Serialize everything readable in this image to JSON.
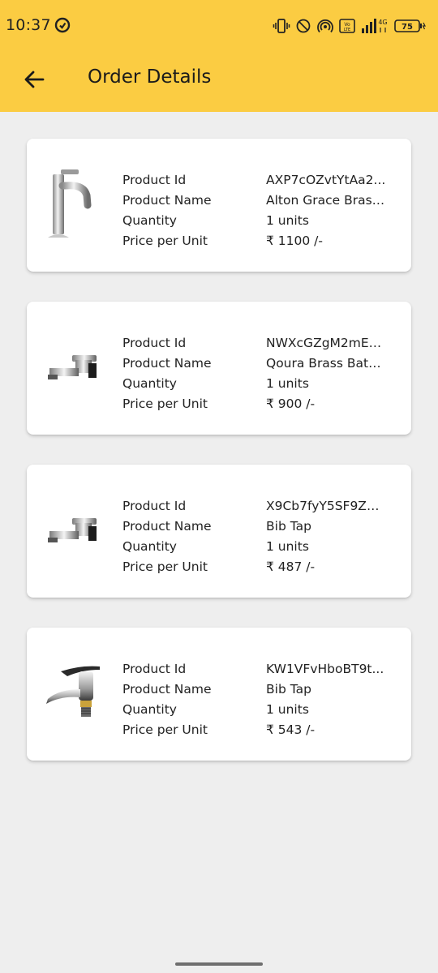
{
  "status_bar": {
    "time": "10:37",
    "network": "4G",
    "battery": "75"
  },
  "app_bar": {
    "title": "Order Details"
  },
  "labels": {
    "product_id": "Product Id",
    "product_name": "Product Name",
    "quantity": "Quantity",
    "price": "Price per Unit"
  },
  "orders": [
    {
      "product_id": "AXP7cOZvtYtAa2...",
      "product_name": "Alton Grace Brass...",
      "quantity": "1 units",
      "price": "₹ 1100 /-",
      "image_icon": "tall-faucet-icon"
    },
    {
      "product_id": "NWXcGZgM2mEE...",
      "product_name": "Qoura Brass Bathr...",
      "quantity": "1 units",
      "price": "₹ 900 /-",
      "image_icon": "bib-tap-square-icon"
    },
    {
      "product_id": "X9Cb7fyY5SF9ZN...",
      "product_name": "Bib Tap",
      "quantity": "1 units",
      "price": "₹ 487 /-",
      "image_icon": "bib-tap-square-icon"
    },
    {
      "product_id": "KW1VFvHboBT9t...",
      "product_name": "Bib Tap",
      "quantity": "1 units",
      "price": "₹ 543 /-",
      "image_icon": "bib-tap-lever-icon"
    }
  ],
  "colors": {
    "accent": "#fbcc42",
    "background": "#eeeeee",
    "card": "#ffffff"
  }
}
